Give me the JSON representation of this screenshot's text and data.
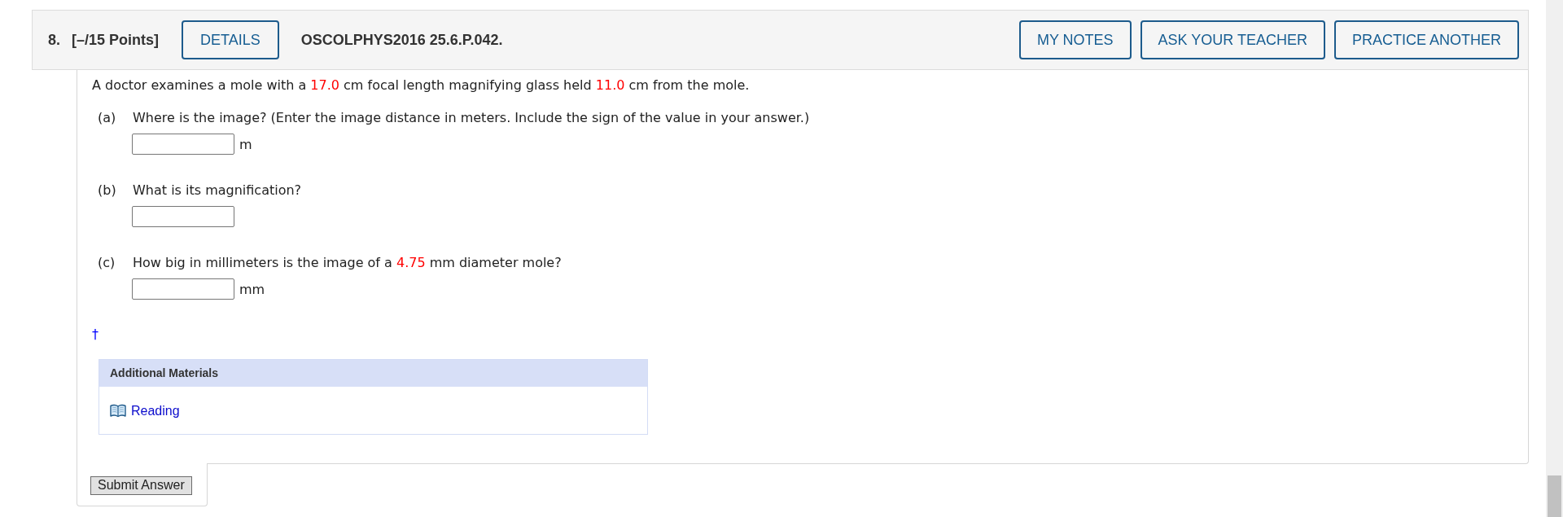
{
  "header": {
    "number": "8.",
    "points": "[–/15 Points]",
    "details_button": "DETAILS",
    "problem_code": "OSCOLPHYS2016 25.6.P.042.",
    "actions": [
      "MY NOTES",
      "ASK YOUR TEACHER",
      "PRACTICE ANOTHER"
    ]
  },
  "problem": {
    "statement": [
      {
        "kind": "text",
        "text": "A doctor examines a mole with a "
      },
      {
        "kind": "value",
        "text": "17.0"
      },
      {
        "kind": "text",
        "text": " cm focal length magnifying glass held "
      },
      {
        "kind": "value",
        "text": "11.0"
      },
      {
        "kind": "text",
        "text": " cm from the mole."
      }
    ],
    "parts": [
      {
        "label": "(a)",
        "question": [
          {
            "kind": "text",
            "text": "Where is the image? (Enter the image distance in meters. Include the sign of the value in your answer.)"
          }
        ],
        "unit": "m"
      },
      {
        "label": "(b)",
        "question": [
          {
            "kind": "text",
            "text": "What is its magnification?"
          }
        ]
      },
      {
        "label": "(c)",
        "question": [
          {
            "kind": "text",
            "text": "How big in millimeters is the image of a "
          },
          {
            "kind": "value",
            "text": "4.75"
          },
          {
            "kind": "text",
            "text": " mm diameter mole?"
          }
        ],
        "unit": "mm"
      }
    ],
    "footnote_mark": "†"
  },
  "additional_materials": {
    "title": "Additional Materials",
    "links": [
      {
        "label": "Reading"
      }
    ]
  },
  "submit_button": "Submit Answer"
}
